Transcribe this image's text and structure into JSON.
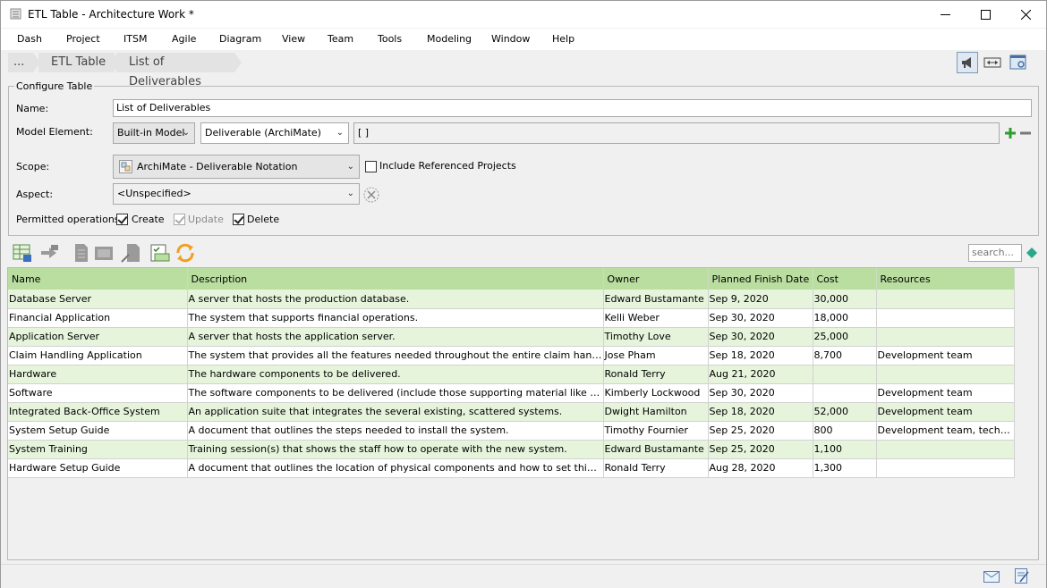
{
  "window": {
    "title": "ETL Table - Architecture Work *",
    "controls": [
      "minimize-icon",
      "maximize-icon",
      "close-icon"
    ]
  },
  "menu": [
    "Dash",
    "Project",
    "ITSM",
    "Agile",
    "Diagram",
    "View",
    "Team",
    "Tools",
    "Modeling",
    "Window",
    "Help"
  ],
  "breadcrumb": [
    "...",
    "ETL Table",
    "List of Deliverables"
  ],
  "config": {
    "legend": "Configure Table",
    "name_label": "Name:",
    "name_value": "List of Deliverables",
    "model_element_label": "Model Element:",
    "model_source": "Built-in Model",
    "model_type": "Deliverable (ArchiMate)",
    "model_filter": "[ ]",
    "scope_label": "Scope:",
    "scope_value": "ArchiMate - Deliverable Notation",
    "include_referenced_label": "Include Referenced Projects",
    "include_referenced_checked": false,
    "aspect_label": "Aspect:",
    "aspect_value": "<Unspecified>",
    "permitted_label": "Permitted operations:",
    "op_create": "Create",
    "op_update": "Update",
    "op_delete": "Delete"
  },
  "search_placeholder": "search...",
  "table": {
    "columns": [
      "Name",
      "Description",
      "Owner",
      "Planned Finish Date",
      "Cost",
      "Resources"
    ],
    "rows": [
      [
        "Database Server",
        "A server that hosts the production database.",
        "Edward Bustamante",
        "Sep 9, 2020",
        "30,000",
        ""
      ],
      [
        "Financial Application",
        "The system that supports financial operations.",
        "Kelli Weber",
        "Sep 30, 2020",
        "18,000",
        ""
      ],
      [
        "Application Server",
        "A server that hosts the application server.",
        "Timothy Love",
        "Sep 30, 2020",
        "25,000",
        ""
      ],
      [
        "Claim Handling Application",
        "The system that provides all the features needed throughout the entire claim handling process.",
        "Jose Pham",
        "Sep 18, 2020",
        "8,700",
        "Development team"
      ],
      [
        "Hardware",
        "The hardware components to be delivered.",
        "Ronald Terry",
        "Aug 21, 2020",
        "",
        ""
      ],
      [
        "Software",
        "The software components to be delivered (include those supporting material like training and ...",
        "Kimberly Lockwood",
        "Sep 30, 2020",
        "",
        "Development team"
      ],
      [
        "Integrated Back-Office System",
        "An application suite that integrates the several existing, scattered systems.",
        "Dwight Hamilton",
        "Sep 18, 2020",
        "52,000",
        "Development team"
      ],
      [
        "System Setup Guide",
        "A document that outlines the steps needed to install the system.",
        "Timothy Fournier",
        "Sep 25, 2020",
        "800",
        "Development team, technica..."
      ],
      [
        "System Training",
        "Training session(s) that shows the staff how to operate with the new system.",
        "Edward Bustamante",
        "Sep 25, 2020",
        "1,100",
        ""
      ],
      [
        "Hardware Setup Guide",
        "A document that outlines the location of physical components and how to set things up.",
        "Ronald Terry",
        "Aug 28, 2020",
        "1,300",
        ""
      ]
    ]
  },
  "colors": {
    "header_green": "#b9dea0",
    "row_green": "#e6f4dc",
    "add_green": "#2e9e2e"
  }
}
